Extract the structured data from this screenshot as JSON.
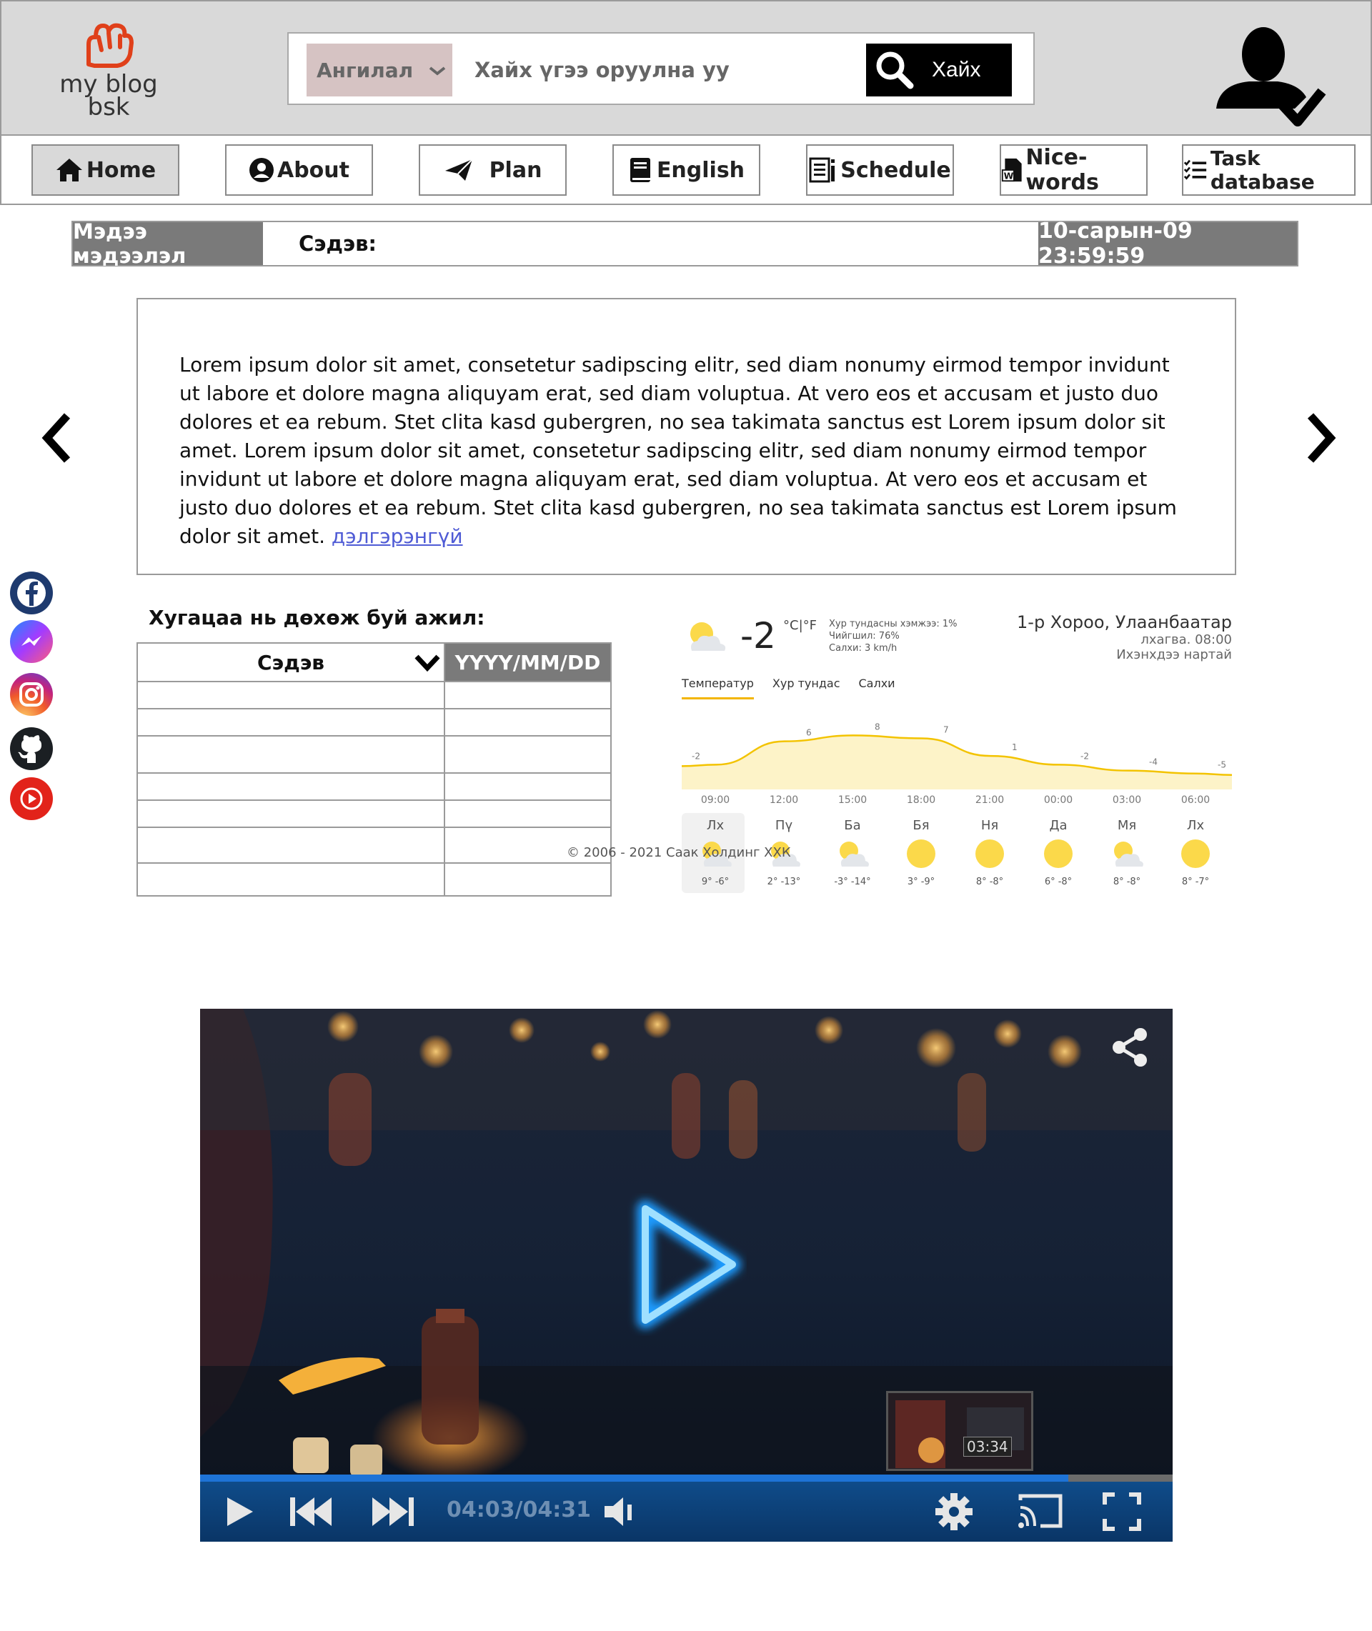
{
  "brand": {
    "line1": "my blog",
    "line2": "bsk"
  },
  "search": {
    "category_label": "Ангилал",
    "placeholder": "Хайх үгээ оруулна уу",
    "button_label": "Хайх"
  },
  "nav": {
    "items": [
      {
        "label": "Home",
        "icon": "home-icon",
        "active": true
      },
      {
        "label": "About",
        "icon": "user-circle-icon"
      },
      {
        "label": "Plan",
        "icon": "paper-plane-icon"
      },
      {
        "label": "English",
        "icon": "book-icon"
      },
      {
        "label": "Schedule",
        "icon": "schedule-icon"
      },
      {
        "label": "Nice-words",
        "icon": "word-doc-icon"
      },
      {
        "label": "Task database",
        "icon": "task-list-icon"
      }
    ]
  },
  "newsbar": {
    "label": "Мэдээ мэдээлэл",
    "topic": "Сэдэв:",
    "datetime": "10-сарын-09 23:59:59"
  },
  "article": {
    "text": "Lorem ipsum dolor sit amet, consetetur sadipscing elitr, sed diam nonumy eirmod tempor invidunt ut labore et dolore magna aliquyam erat, sed diam voluptua. At vero eos et accusam et justo duo dolores et ea rebum. Stet clita kasd gubergren, no sea takimata sanctus est Lorem ipsum dolor sit amet. Lorem ipsum dolor sit amet, consetetur sadipscing elitr, sed diam nonumy eirmod tempor invidunt ut labore et dolore magna aliquyam erat, sed diam voluptua. At vero eos et accusam et justo duo dolores et ea rebum. Stet clita kasd gubergren, no sea takimata sanctus est Lorem ipsum dolor sit amet. ",
    "more_link": "дэлгэрэнгүй"
  },
  "social": [
    "facebook-icon",
    "messenger-icon",
    "instagram-icon",
    "github-icon",
    "youtube-icon"
  ],
  "tasks": {
    "title": "Хугацаа нь дөхөж буй ажил:",
    "col_topic": "Сэдэв",
    "col_date": "YYYY/MM/DD",
    "rows": 7
  },
  "weather": {
    "temp": "-2",
    "unit": "°C|°F",
    "details": [
      "Хур тундасны хэмжээ: 1%",
      "Чийгшил: 76%",
      "Салхи: 3 km/h"
    ],
    "location": "1-р Хороо, Улаанбаатар",
    "day_time": "лхагва. 08:00",
    "condition": "Ихэнхдээ нартай",
    "tabs": [
      "Температур",
      "Хур тундас",
      "Салхи"
    ],
    "chart_labels": [
      "-2",
      "6",
      "8",
      "7",
      "1",
      "-2",
      "-4",
      "-5"
    ],
    "hours": [
      "09:00",
      "12:00",
      "15:00",
      "18:00",
      "21:00",
      "00:00",
      "03:00",
      "06:00"
    ],
    "days": [
      {
        "name": "Лх",
        "range": "9° -6°",
        "icon": "partly-cloudy-icon"
      },
      {
        "name": "Пү",
        "range": "2° -13°",
        "icon": "partly-cloudy-icon"
      },
      {
        "name": "Ба",
        "range": "-3° -14°",
        "icon": "partly-cloudy-icon"
      },
      {
        "name": "Бя",
        "range": "3° -9°",
        "icon": "sun-icon"
      },
      {
        "name": "Ня",
        "range": "8° -8°",
        "icon": "sun-icon"
      },
      {
        "name": "Да",
        "range": "6° -8°",
        "icon": "sun-icon"
      },
      {
        "name": "Мя",
        "range": "8° -8°",
        "icon": "partly-cloudy-icon"
      },
      {
        "name": "Лх",
        "range": "8° -7°",
        "icon": "sun-icon"
      }
    ],
    "colors": {
      "line": "#f3c300",
      "fill": "#fdf3c8",
      "sun": "#fbd94a"
    }
  },
  "footer": "© 2006 - 2021 Саак Холдинг ХХК",
  "video": {
    "time": "04:03/04:31",
    "progress": 0.893,
    "preview_time": "03:34"
  }
}
